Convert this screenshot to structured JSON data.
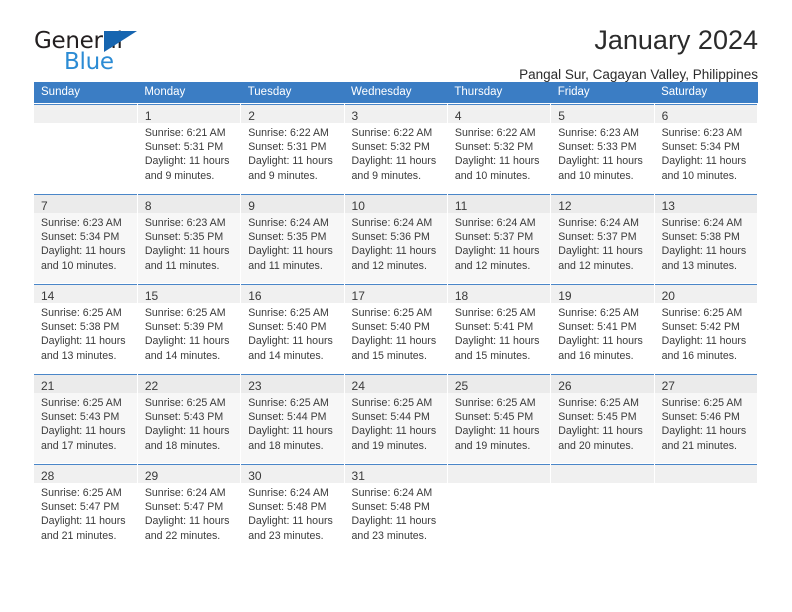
{
  "brand": {
    "name_top": "General",
    "name_bottom": "Blue",
    "accent_color": "#2b8bd4",
    "triangle_color": "#1665b0"
  },
  "header": {
    "title": "January 2024",
    "subtitle": "Pangal Sur, Cagayan Valley, Philippines"
  },
  "calendar": {
    "header_bg": "#3b7dc4",
    "header_text_color": "#ffffff",
    "weekdays": [
      "Sunday",
      "Monday",
      "Tuesday",
      "Wednesday",
      "Thursday",
      "Friday",
      "Saturday"
    ],
    "labels": {
      "sunrise": "Sunrise:",
      "sunset": "Sunset:",
      "daylight": "Daylight:"
    },
    "weeks": [
      [
        {
          "day": "",
          "sunrise": "",
          "sunset": "",
          "daylight": ""
        },
        {
          "day": "1",
          "sunrise": "Sunrise: 6:21 AM",
          "sunset": "Sunset: 5:31 PM",
          "daylight": "Daylight: 11 hours and 9 minutes."
        },
        {
          "day": "2",
          "sunrise": "Sunrise: 6:22 AM",
          "sunset": "Sunset: 5:31 PM",
          "daylight": "Daylight: 11 hours and 9 minutes."
        },
        {
          "day": "3",
          "sunrise": "Sunrise: 6:22 AM",
          "sunset": "Sunset: 5:32 PM",
          "daylight": "Daylight: 11 hours and 9 minutes."
        },
        {
          "day": "4",
          "sunrise": "Sunrise: 6:22 AM",
          "sunset": "Sunset: 5:32 PM",
          "daylight": "Daylight: 11 hours and 10 minutes."
        },
        {
          "day": "5",
          "sunrise": "Sunrise: 6:23 AM",
          "sunset": "Sunset: 5:33 PM",
          "daylight": "Daylight: 11 hours and 10 minutes."
        },
        {
          "day": "6",
          "sunrise": "Sunrise: 6:23 AM",
          "sunset": "Sunset: 5:34 PM",
          "daylight": "Daylight: 11 hours and 10 minutes."
        }
      ],
      [
        {
          "day": "7",
          "sunrise": "Sunrise: 6:23 AM",
          "sunset": "Sunset: 5:34 PM",
          "daylight": "Daylight: 11 hours and 10 minutes."
        },
        {
          "day": "8",
          "sunrise": "Sunrise: 6:23 AM",
          "sunset": "Sunset: 5:35 PM",
          "daylight": "Daylight: 11 hours and 11 minutes."
        },
        {
          "day": "9",
          "sunrise": "Sunrise: 6:24 AM",
          "sunset": "Sunset: 5:35 PM",
          "daylight": "Daylight: 11 hours and 11 minutes."
        },
        {
          "day": "10",
          "sunrise": "Sunrise: 6:24 AM",
          "sunset": "Sunset: 5:36 PM",
          "daylight": "Daylight: 11 hours and 12 minutes."
        },
        {
          "day": "11",
          "sunrise": "Sunrise: 6:24 AM",
          "sunset": "Sunset: 5:37 PM",
          "daylight": "Daylight: 11 hours and 12 minutes."
        },
        {
          "day": "12",
          "sunrise": "Sunrise: 6:24 AM",
          "sunset": "Sunset: 5:37 PM",
          "daylight": "Daylight: 11 hours and 12 minutes."
        },
        {
          "day": "13",
          "sunrise": "Sunrise: 6:24 AM",
          "sunset": "Sunset: 5:38 PM",
          "daylight": "Daylight: 11 hours and 13 minutes."
        }
      ],
      [
        {
          "day": "14",
          "sunrise": "Sunrise: 6:25 AM",
          "sunset": "Sunset: 5:38 PM",
          "daylight": "Daylight: 11 hours and 13 minutes."
        },
        {
          "day": "15",
          "sunrise": "Sunrise: 6:25 AM",
          "sunset": "Sunset: 5:39 PM",
          "daylight": "Daylight: 11 hours and 14 minutes."
        },
        {
          "day": "16",
          "sunrise": "Sunrise: 6:25 AM",
          "sunset": "Sunset: 5:40 PM",
          "daylight": "Daylight: 11 hours and 14 minutes."
        },
        {
          "day": "17",
          "sunrise": "Sunrise: 6:25 AM",
          "sunset": "Sunset: 5:40 PM",
          "daylight": "Daylight: 11 hours and 15 minutes."
        },
        {
          "day": "18",
          "sunrise": "Sunrise: 6:25 AM",
          "sunset": "Sunset: 5:41 PM",
          "daylight": "Daylight: 11 hours and 15 minutes."
        },
        {
          "day": "19",
          "sunrise": "Sunrise: 6:25 AM",
          "sunset": "Sunset: 5:41 PM",
          "daylight": "Daylight: 11 hours and 16 minutes."
        },
        {
          "day": "20",
          "sunrise": "Sunrise: 6:25 AM",
          "sunset": "Sunset: 5:42 PM",
          "daylight": "Daylight: 11 hours and 16 minutes."
        }
      ],
      [
        {
          "day": "21",
          "sunrise": "Sunrise: 6:25 AM",
          "sunset": "Sunset: 5:43 PM",
          "daylight": "Daylight: 11 hours and 17 minutes."
        },
        {
          "day": "22",
          "sunrise": "Sunrise: 6:25 AM",
          "sunset": "Sunset: 5:43 PM",
          "daylight": "Daylight: 11 hours and 18 minutes."
        },
        {
          "day": "23",
          "sunrise": "Sunrise: 6:25 AM",
          "sunset": "Sunset: 5:44 PM",
          "daylight": "Daylight: 11 hours and 18 minutes."
        },
        {
          "day": "24",
          "sunrise": "Sunrise: 6:25 AM",
          "sunset": "Sunset: 5:44 PM",
          "daylight": "Daylight: 11 hours and 19 minutes."
        },
        {
          "day": "25",
          "sunrise": "Sunrise: 6:25 AM",
          "sunset": "Sunset: 5:45 PM",
          "daylight": "Daylight: 11 hours and 19 minutes."
        },
        {
          "day": "26",
          "sunrise": "Sunrise: 6:25 AM",
          "sunset": "Sunset: 5:45 PM",
          "daylight": "Daylight: 11 hours and 20 minutes."
        },
        {
          "day": "27",
          "sunrise": "Sunrise: 6:25 AM",
          "sunset": "Sunset: 5:46 PM",
          "daylight": "Daylight: 11 hours and 21 minutes."
        }
      ],
      [
        {
          "day": "28",
          "sunrise": "Sunrise: 6:25 AM",
          "sunset": "Sunset: 5:47 PM",
          "daylight": "Daylight: 11 hours and 21 minutes."
        },
        {
          "day": "29",
          "sunrise": "Sunrise: 6:24 AM",
          "sunset": "Sunset: 5:47 PM",
          "daylight": "Daylight: 11 hours and 22 minutes."
        },
        {
          "day": "30",
          "sunrise": "Sunrise: 6:24 AM",
          "sunset": "Sunset: 5:48 PM",
          "daylight": "Daylight: 11 hours and 23 minutes."
        },
        {
          "day": "31",
          "sunrise": "Sunrise: 6:24 AM",
          "sunset": "Sunset: 5:48 PM",
          "daylight": "Daylight: 11 hours and 23 minutes."
        },
        {
          "day": "",
          "sunrise": "",
          "sunset": "",
          "daylight": ""
        },
        {
          "day": "",
          "sunrise": "",
          "sunset": "",
          "daylight": ""
        },
        {
          "day": "",
          "sunrise": "",
          "sunset": "",
          "daylight": ""
        }
      ]
    ]
  }
}
